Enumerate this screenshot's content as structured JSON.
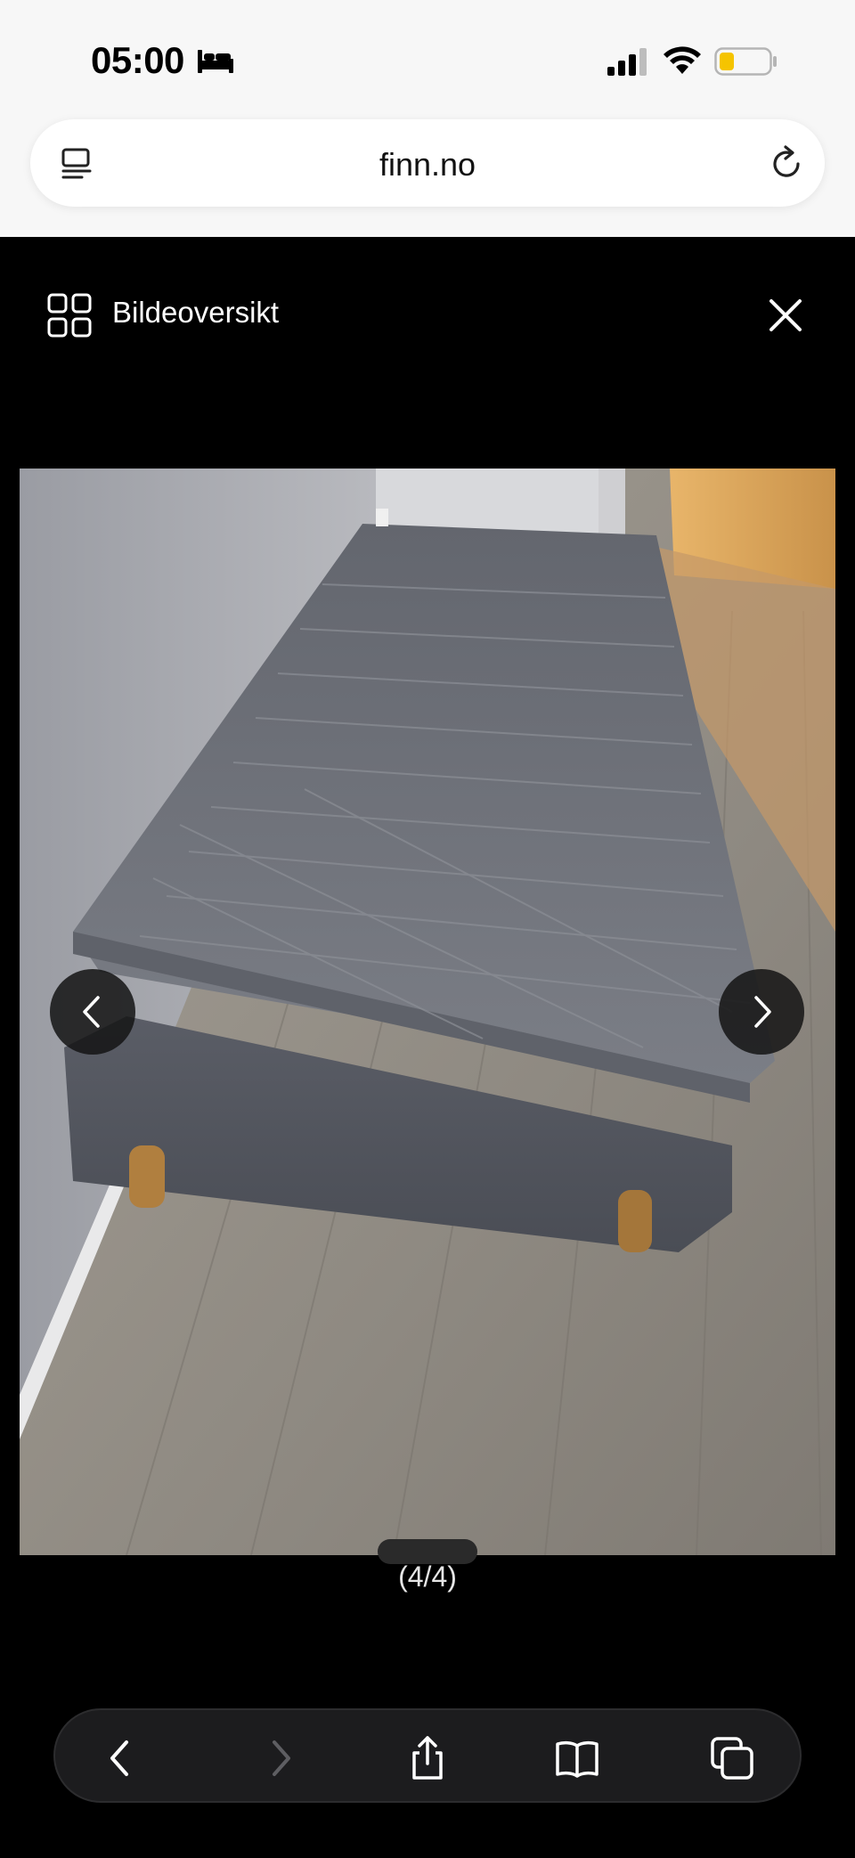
{
  "status_bar": {
    "time": "05:00",
    "icons": [
      "bed-icon",
      "signal-icon",
      "wifi-icon",
      "battery-icon"
    ],
    "battery_color": "#f5c400"
  },
  "browser": {
    "url": "finn.no",
    "icons": [
      "reader-icon",
      "reload-icon"
    ]
  },
  "viewer": {
    "overview_label": "Bildeoversikt",
    "counter": "(4/4)",
    "icons": [
      "grid-icon",
      "close-icon",
      "chevron-left-icon",
      "chevron-right-icon"
    ]
  },
  "toolbar": {
    "icons": [
      "back-icon",
      "forward-icon",
      "share-icon",
      "bookmarks-icon",
      "tabs-icon"
    ]
  }
}
